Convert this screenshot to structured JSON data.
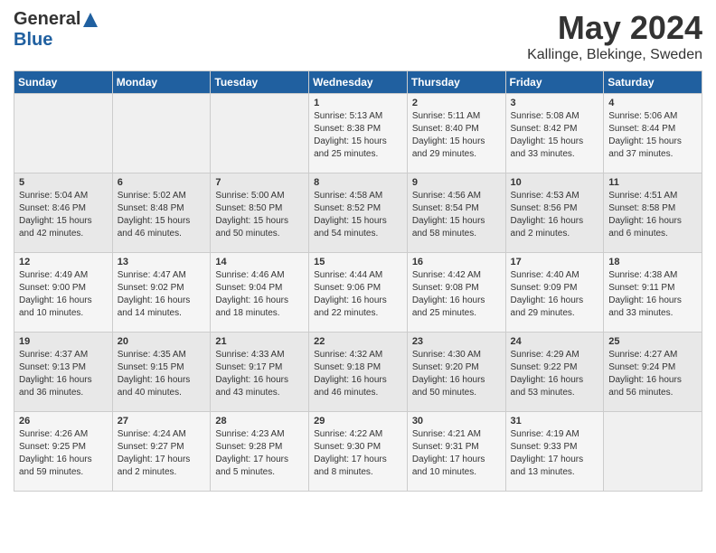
{
  "header": {
    "logo_general": "General",
    "logo_blue": "Blue",
    "month_title": "May 2024",
    "location": "Kallinge, Blekinge, Sweden"
  },
  "weekdays": [
    "Sunday",
    "Monday",
    "Tuesday",
    "Wednesday",
    "Thursday",
    "Friday",
    "Saturday"
  ],
  "weeks": [
    [
      {
        "day": "",
        "info": ""
      },
      {
        "day": "",
        "info": ""
      },
      {
        "day": "",
        "info": ""
      },
      {
        "day": "1",
        "info": "Sunrise: 5:13 AM\nSunset: 8:38 PM\nDaylight: 15 hours\nand 25 minutes."
      },
      {
        "day": "2",
        "info": "Sunrise: 5:11 AM\nSunset: 8:40 PM\nDaylight: 15 hours\nand 29 minutes."
      },
      {
        "day": "3",
        "info": "Sunrise: 5:08 AM\nSunset: 8:42 PM\nDaylight: 15 hours\nand 33 minutes."
      },
      {
        "day": "4",
        "info": "Sunrise: 5:06 AM\nSunset: 8:44 PM\nDaylight: 15 hours\nand 37 minutes."
      }
    ],
    [
      {
        "day": "5",
        "info": "Sunrise: 5:04 AM\nSunset: 8:46 PM\nDaylight: 15 hours\nand 42 minutes."
      },
      {
        "day": "6",
        "info": "Sunrise: 5:02 AM\nSunset: 8:48 PM\nDaylight: 15 hours\nand 46 minutes."
      },
      {
        "day": "7",
        "info": "Sunrise: 5:00 AM\nSunset: 8:50 PM\nDaylight: 15 hours\nand 50 minutes."
      },
      {
        "day": "8",
        "info": "Sunrise: 4:58 AM\nSunset: 8:52 PM\nDaylight: 15 hours\nand 54 minutes."
      },
      {
        "day": "9",
        "info": "Sunrise: 4:56 AM\nSunset: 8:54 PM\nDaylight: 15 hours\nand 58 minutes."
      },
      {
        "day": "10",
        "info": "Sunrise: 4:53 AM\nSunset: 8:56 PM\nDaylight: 16 hours\nand 2 minutes."
      },
      {
        "day": "11",
        "info": "Sunrise: 4:51 AM\nSunset: 8:58 PM\nDaylight: 16 hours\nand 6 minutes."
      }
    ],
    [
      {
        "day": "12",
        "info": "Sunrise: 4:49 AM\nSunset: 9:00 PM\nDaylight: 16 hours\nand 10 minutes."
      },
      {
        "day": "13",
        "info": "Sunrise: 4:47 AM\nSunset: 9:02 PM\nDaylight: 16 hours\nand 14 minutes."
      },
      {
        "day": "14",
        "info": "Sunrise: 4:46 AM\nSunset: 9:04 PM\nDaylight: 16 hours\nand 18 minutes."
      },
      {
        "day": "15",
        "info": "Sunrise: 4:44 AM\nSunset: 9:06 PM\nDaylight: 16 hours\nand 22 minutes."
      },
      {
        "day": "16",
        "info": "Sunrise: 4:42 AM\nSunset: 9:08 PM\nDaylight: 16 hours\nand 25 minutes."
      },
      {
        "day": "17",
        "info": "Sunrise: 4:40 AM\nSunset: 9:09 PM\nDaylight: 16 hours\nand 29 minutes."
      },
      {
        "day": "18",
        "info": "Sunrise: 4:38 AM\nSunset: 9:11 PM\nDaylight: 16 hours\nand 33 minutes."
      }
    ],
    [
      {
        "day": "19",
        "info": "Sunrise: 4:37 AM\nSunset: 9:13 PM\nDaylight: 16 hours\nand 36 minutes."
      },
      {
        "day": "20",
        "info": "Sunrise: 4:35 AM\nSunset: 9:15 PM\nDaylight: 16 hours\nand 40 minutes."
      },
      {
        "day": "21",
        "info": "Sunrise: 4:33 AM\nSunset: 9:17 PM\nDaylight: 16 hours\nand 43 minutes."
      },
      {
        "day": "22",
        "info": "Sunrise: 4:32 AM\nSunset: 9:18 PM\nDaylight: 16 hours\nand 46 minutes."
      },
      {
        "day": "23",
        "info": "Sunrise: 4:30 AM\nSunset: 9:20 PM\nDaylight: 16 hours\nand 50 minutes."
      },
      {
        "day": "24",
        "info": "Sunrise: 4:29 AM\nSunset: 9:22 PM\nDaylight: 16 hours\nand 53 minutes."
      },
      {
        "day": "25",
        "info": "Sunrise: 4:27 AM\nSunset: 9:24 PM\nDaylight: 16 hours\nand 56 minutes."
      }
    ],
    [
      {
        "day": "26",
        "info": "Sunrise: 4:26 AM\nSunset: 9:25 PM\nDaylight: 16 hours\nand 59 minutes."
      },
      {
        "day": "27",
        "info": "Sunrise: 4:24 AM\nSunset: 9:27 PM\nDaylight: 17 hours\nand 2 minutes."
      },
      {
        "day": "28",
        "info": "Sunrise: 4:23 AM\nSunset: 9:28 PM\nDaylight: 17 hours\nand 5 minutes."
      },
      {
        "day": "29",
        "info": "Sunrise: 4:22 AM\nSunset: 9:30 PM\nDaylight: 17 hours\nand 8 minutes."
      },
      {
        "day": "30",
        "info": "Sunrise: 4:21 AM\nSunset: 9:31 PM\nDaylight: 17 hours\nand 10 minutes."
      },
      {
        "day": "31",
        "info": "Sunrise: 4:19 AM\nSunset: 9:33 PM\nDaylight: 17 hours\nand 13 minutes."
      },
      {
        "day": "",
        "info": ""
      }
    ]
  ]
}
